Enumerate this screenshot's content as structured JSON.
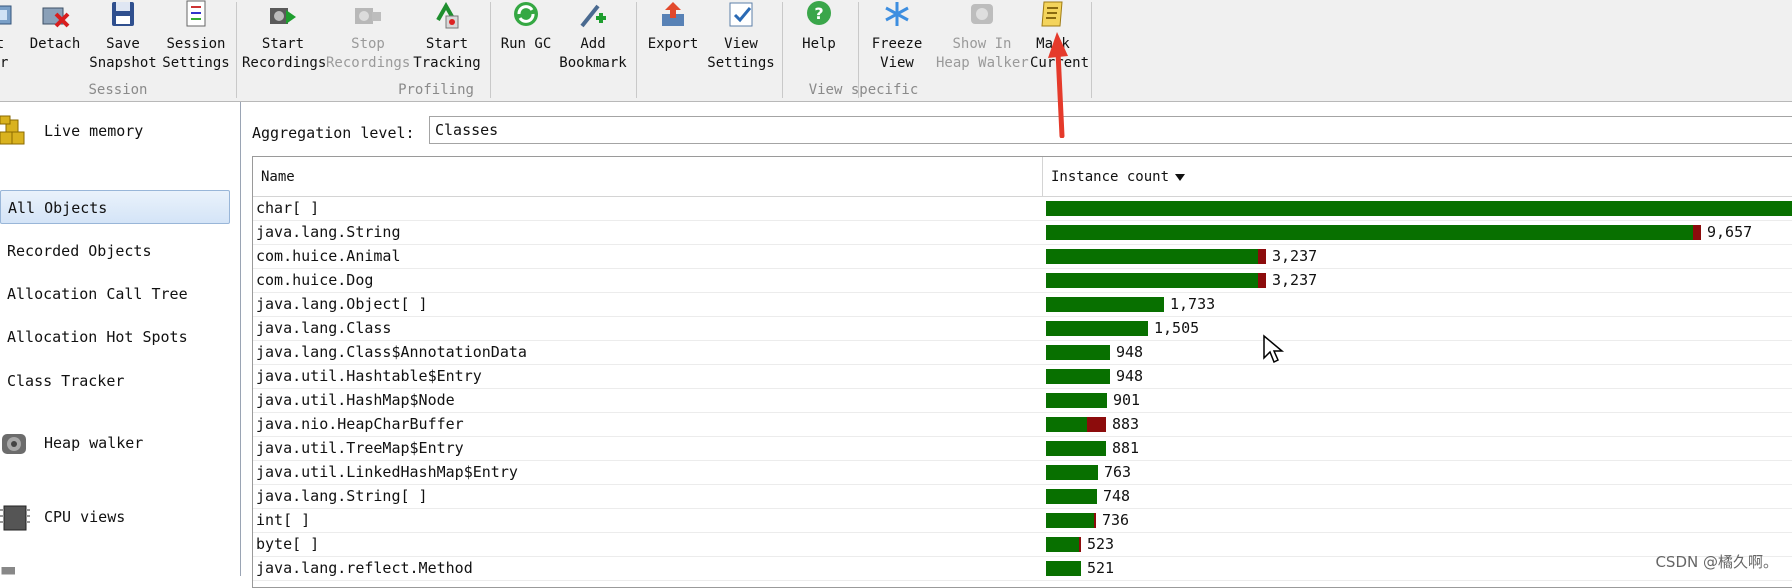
{
  "toolbar": {
    "buttons": [
      {
        "id": "start-center",
        "label": "t\ner",
        "disabled": false
      },
      {
        "id": "detach",
        "label": "Detach",
        "disabled": false
      },
      {
        "id": "save-snapshot",
        "label": "Save\nSnapshot",
        "disabled": false
      },
      {
        "id": "session-settings",
        "label": "Session\nSettings",
        "disabled": false
      },
      {
        "id": "start-recordings",
        "label": "Start\nRecordings",
        "disabled": false
      },
      {
        "id": "stop-recordings",
        "label": "Stop\nRecordings",
        "disabled": true
      },
      {
        "id": "start-tracking",
        "label": "Start\nTracking",
        "disabled": false
      },
      {
        "id": "run-gc",
        "label": "Run GC",
        "disabled": false
      },
      {
        "id": "add-bookmark",
        "label": "Add\nBookmark",
        "disabled": false
      },
      {
        "id": "export",
        "label": "Export",
        "disabled": false
      },
      {
        "id": "view-settings",
        "label": "View\nSettings",
        "disabled": false
      },
      {
        "id": "help",
        "label": "Help",
        "disabled": false
      },
      {
        "id": "freeze-view",
        "label": "Freeze\nView",
        "disabled": false
      },
      {
        "id": "show-in-heap-walker",
        "label": "Show In\nHeap Walker",
        "disabled": true
      },
      {
        "id": "mark-current",
        "label": "Mark\nCurrent",
        "disabled": false
      }
    ],
    "groups": {
      "session": "Session",
      "profiling": "Profiling",
      "view_specific": "View specific"
    }
  },
  "sidebar": {
    "live_memory": "Live memory",
    "items": [
      "All Objects",
      "Recorded Objects",
      "Allocation Call Tree",
      "Allocation Hot Spots",
      "Class Tracker"
    ],
    "active_index": 0,
    "heap_walker": "Heap walker",
    "cpu_views": "CPU views"
  },
  "aggregation": {
    "label": "Aggregation level:",
    "value": "Classes"
  },
  "table": {
    "columns": {
      "name": "Name",
      "count": "Instance count"
    },
    "max_value": 11200,
    "rows": [
      {
        "name": "char[ ]",
        "value": 11200,
        "label": "",
        "recorded": 0
      },
      {
        "name": "java.lang.String",
        "value": 9657,
        "label": "9,657",
        "recorded": 120
      },
      {
        "name": "com.huice.Animal",
        "value": 3237,
        "label": "3,237",
        "recorded": 120
      },
      {
        "name": "com.huice.Dog",
        "value": 3237,
        "label": "3,237",
        "recorded": 120
      },
      {
        "name": "java.lang.Object[ ]",
        "value": 1733,
        "label": "1,733",
        "recorded": 0
      },
      {
        "name": "java.lang.Class",
        "value": 1505,
        "label": "1,505",
        "recorded": 0
      },
      {
        "name": "java.lang.Class$AnnotationData",
        "value": 948,
        "label": "948",
        "recorded": 0
      },
      {
        "name": "java.util.Hashtable$Entry",
        "value": 948,
        "label": "948",
        "recorded": 0
      },
      {
        "name": "java.util.HashMap$Node",
        "value": 901,
        "label": "901",
        "recorded": 0
      },
      {
        "name": "java.nio.HeapCharBuffer",
        "value": 883,
        "label": "883",
        "recorded": 280
      },
      {
        "name": "java.util.TreeMap$Entry",
        "value": 881,
        "label": "881",
        "recorded": 0
      },
      {
        "name": "java.util.LinkedHashMap$Entry",
        "value": 763,
        "label": "763",
        "recorded": 0
      },
      {
        "name": "java.lang.String[ ]",
        "value": 748,
        "label": "748",
        "recorded": 0
      },
      {
        "name": "int[ ]",
        "value": 736,
        "label": "736",
        "recorded": 30
      },
      {
        "name": "byte[ ]",
        "value": 523,
        "label": "523",
        "recorded": 30
      },
      {
        "name": "java.lang.reflect.Method",
        "value": 521,
        "label": "521",
        "recorded": 0
      }
    ]
  },
  "colors": {
    "bar_green": "#087000",
    "bar_red": "#8c0c0c",
    "annotation": "#e53a2b"
  },
  "watermark": "CSDN @橘久啊。"
}
